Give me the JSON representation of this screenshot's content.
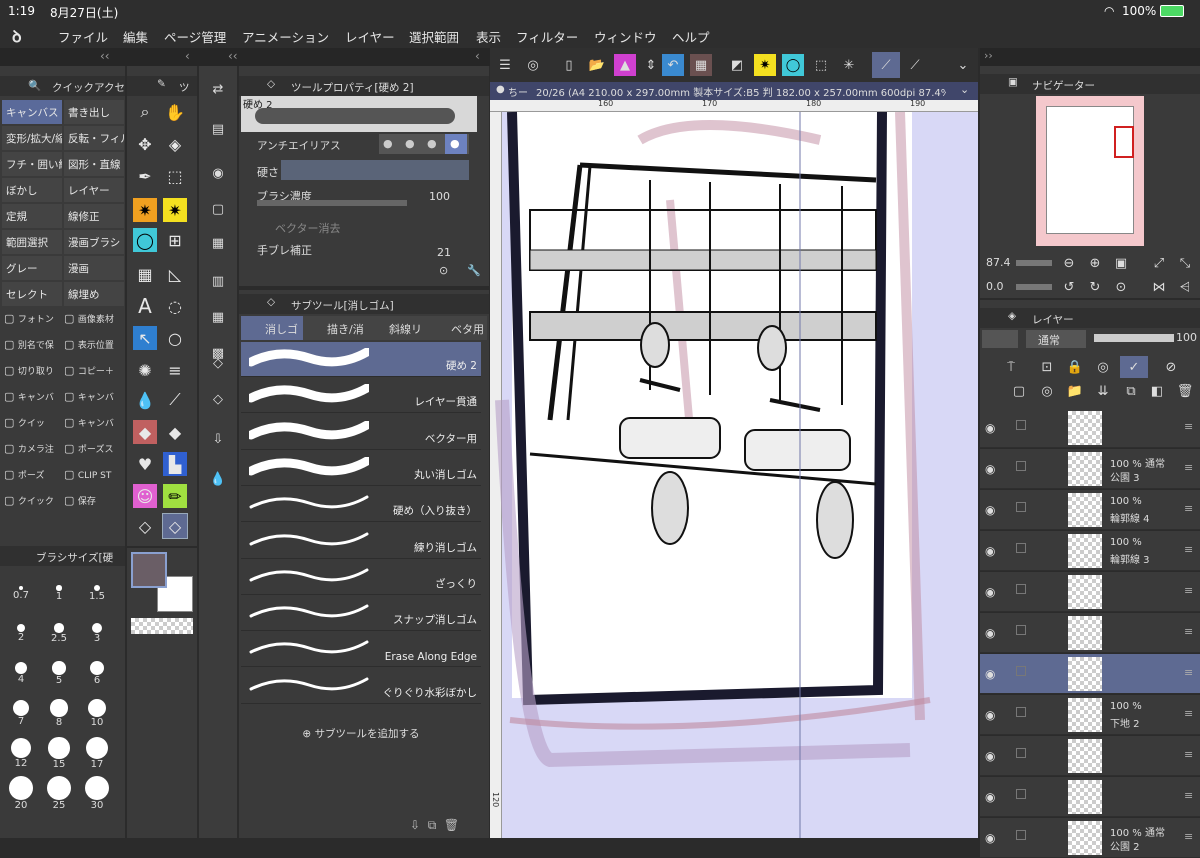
{
  "status": {
    "time": "1:19",
    "date": "8月27日(土)",
    "battery": "100%"
  },
  "menu": [
    "ファイル",
    "編集",
    "ページ管理",
    "アニメーション",
    "レイヤー",
    "選択範囲",
    "表示",
    "フィルター",
    "ウィンドウ",
    "ヘルプ"
  ],
  "quick_access": {
    "title": "クイックアクセ",
    "items": [
      "キャンバス",
      "書き出し",
      "変形/拡大/縮",
      "反転・フィル",
      "フチ・囲い線",
      "図形・直線",
      "ぼかし",
      "レイヤー",
      "定規",
      "線修正",
      "範囲選択",
      "漫画ブラシ",
      "グレー",
      "漫画",
      "セレクト",
      "線埋め"
    ],
    "tools": [
      "フォトン",
      "画像素材",
      "別名で保",
      "表示位置",
      "切り取り",
      "コピー＋",
      "キャンバ",
      "キャンバ",
      "クイッ",
      "キャンバ",
      "カメラ注",
      "ポーズス",
      "ポーズ",
      "CLIP ST",
      "クイック",
      "保存"
    ]
  },
  "tool_palette": {
    "title": "ツ"
  },
  "tool_property": {
    "title": "ツールプロパティ[硬め 2]",
    "brush_name": "硬め 2",
    "antialias": "アンチエイリアス",
    "hardness": "硬さ",
    "density_label": "ブラシ濃度",
    "density_value": "100",
    "vector_erase": "ベクター消去",
    "stabilization_label": "手ブレ補正",
    "stabilization_value": "21"
  },
  "subtool": {
    "title": "サブツール[消しゴム]",
    "tabs": [
      "消しゴ",
      "描き/消",
      "斜線リ",
      "ベタ用"
    ],
    "items": [
      "硬め 2",
      "レイヤー貫通",
      "ベクター用",
      "丸い消しゴム",
      "硬め（入り抜き）",
      "練り消しゴム",
      "ざっくり",
      "スナップ消しゴム",
      "Erase Along Edge",
      "ぐりぐり水彩ぼかし"
    ],
    "add": "サブツールを追加する"
  },
  "brush_size": {
    "title": "ブラシサイズ[硬",
    "values": [
      "0.7",
      "1",
      "1.5",
      "2",
      "2.5",
      "3",
      "4",
      "5",
      "6",
      "7",
      "8",
      "10",
      "12",
      "15",
      "17",
      "20",
      "25",
      "30"
    ]
  },
  "canvas": {
    "tab_title": "ちー",
    "info": "20/26 (A4 210.00 x 297.00mm 製本サイズ:B5 判 182.00 x 257.00mm 600dpi 87.4%)",
    "ruler_top": [
      "160",
      "170",
      "180",
      "190"
    ],
    "ruler_left": [
      "120"
    ]
  },
  "navigator": {
    "title": "ナビゲーター",
    "zoom": "87.4",
    "angle": "0.0"
  },
  "layers": {
    "title": "レイヤー",
    "blend": "通常",
    "opacity": "100",
    "rows": [
      {
        "title": "",
        "sub": ""
      },
      {
        "title": "100 % 通常",
        "sub": "公園 3"
      },
      {
        "title": "100 %",
        "sub": "輪郭線 4"
      },
      {
        "title": "100 %",
        "sub": "輪郭線 3"
      },
      {
        "title": "",
        "sub": ""
      },
      {
        "title": "",
        "sub": ""
      },
      {
        "title": "",
        "sub": ""
      },
      {
        "title": "100 %",
        "sub": "下地 2"
      },
      {
        "title": "",
        "sub": ""
      },
      {
        "title": "",
        "sub": ""
      },
      {
        "title": "100 % 通常",
        "sub": "公園 2"
      }
    ]
  },
  "colors": {
    "main": "#6a5e66",
    "sub": "#ffffff",
    "accent": "#5e6a92"
  }
}
